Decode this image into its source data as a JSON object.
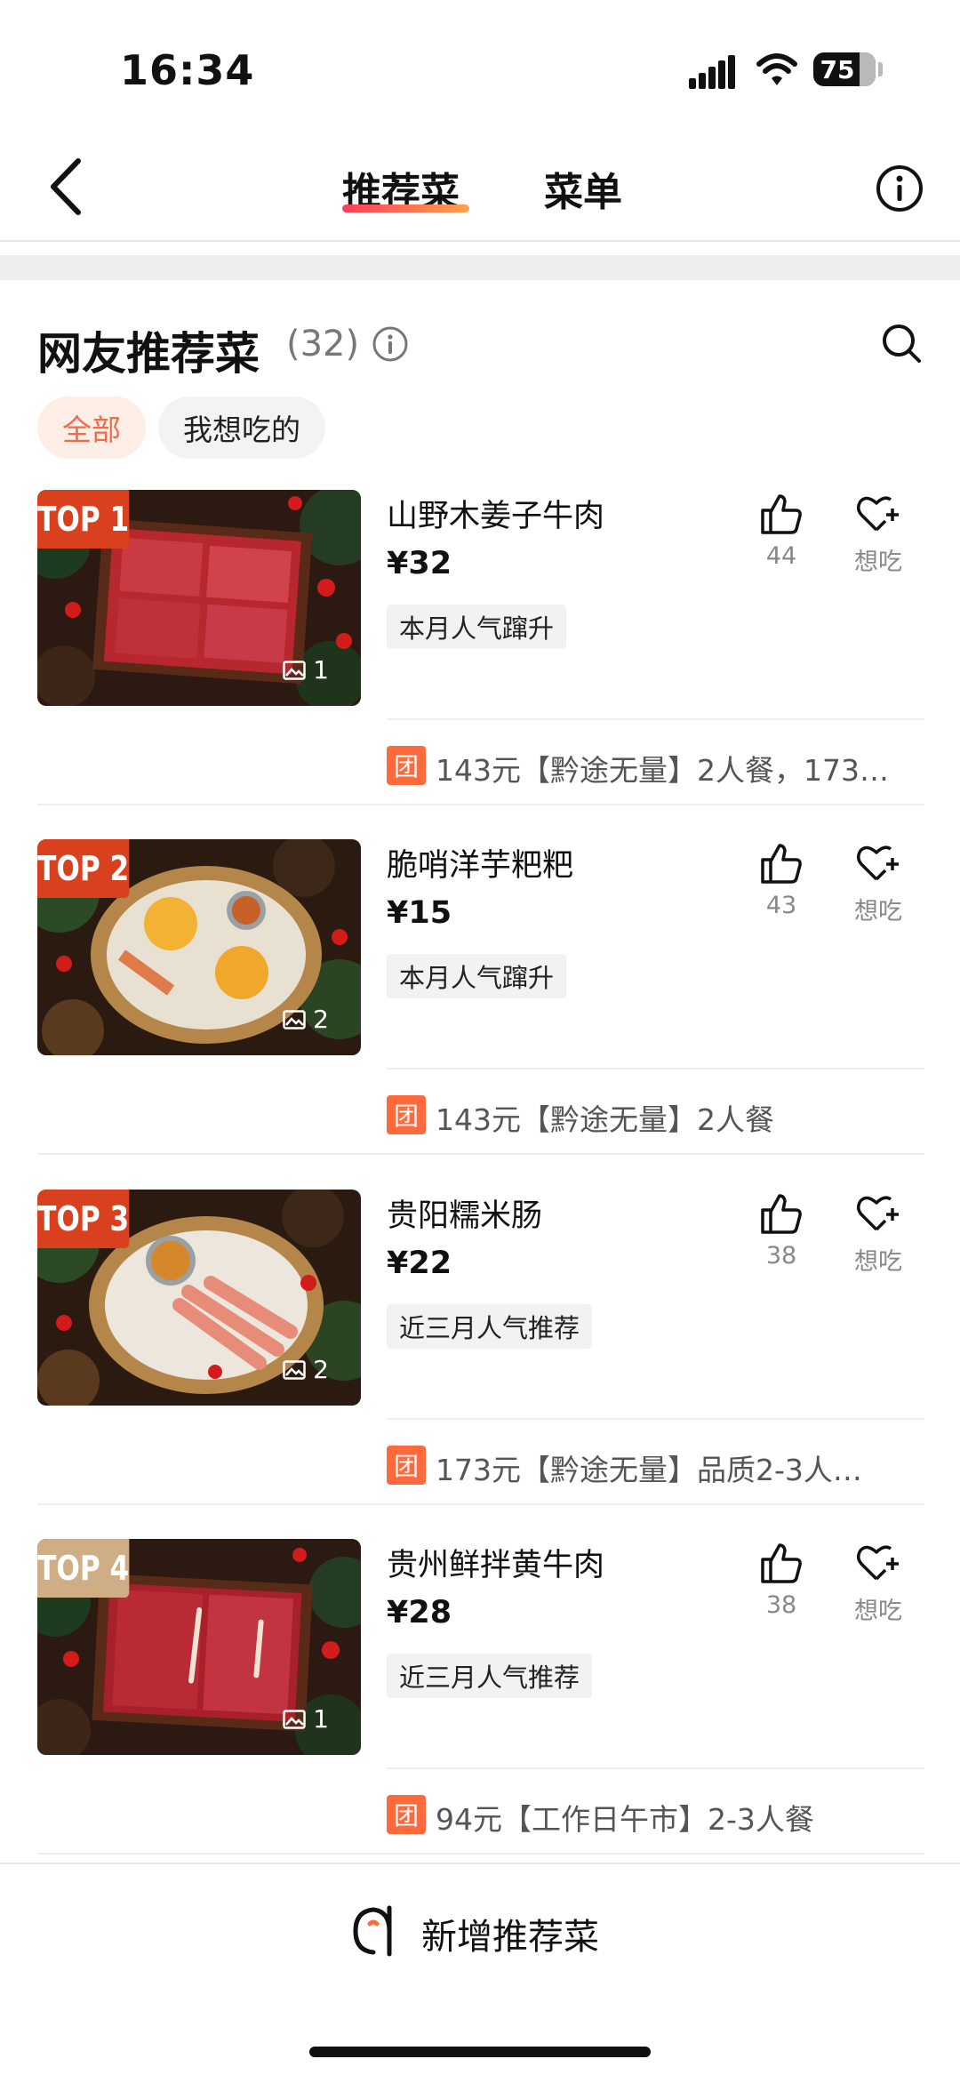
{
  "status_bar": {
    "time": "16:34",
    "battery": "75",
    "battery_level": 0.75
  },
  "nav": {
    "back_icon": "chevron-left-icon",
    "tabs": [
      {
        "label": "推荐菜",
        "active": true
      },
      {
        "label": "菜单",
        "active": false
      }
    ],
    "info_icon": "info-icon"
  },
  "section": {
    "title": "网友推荐菜",
    "count": "(32)",
    "filters": [
      {
        "label": "全部",
        "active": true
      },
      {
        "label": "我想吃的",
        "active": false
      }
    ]
  },
  "colors": {
    "accent": "#f26b46",
    "top_badge": "#d9411e",
    "top_badge_4": "#cfae86",
    "deal_icon": "#ff6a3d"
  },
  "dishes": [
    {
      "rank": "TOP 1",
      "name": "山野木姜子牛肉",
      "price": "¥32",
      "tag": "本月人气蹿升",
      "photos": "1",
      "likes": "44",
      "want_label": "想吃",
      "deal_icon": "团",
      "deal": "143元【黔途无量】2人餐，173…"
    },
    {
      "rank": "TOP 2",
      "name": "脆哨洋芋粑粑",
      "price": "¥15",
      "tag": "本月人气蹿升",
      "photos": "2",
      "likes": "43",
      "want_label": "想吃",
      "deal_icon": "团",
      "deal": "143元【黔途无量】2人餐"
    },
    {
      "rank": "TOP 3",
      "name": "贵阳糯米肠",
      "price": "¥22",
      "tag": "近三月人气推荐",
      "photos": "2",
      "likes": "38",
      "want_label": "想吃",
      "deal_icon": "团",
      "deal": "173元【黔途无量】品质2-3人…"
    },
    {
      "rank": "TOP 4",
      "name": "贵州鲜拌黄牛肉",
      "price": "¥28",
      "tag": "近三月人气推荐",
      "photos": "1",
      "likes": "38",
      "want_label": "想吃",
      "deal_icon": "团",
      "deal": "94元【工作日午市】2-3人餐"
    }
  ],
  "bottom": {
    "add_label": "新增推荐菜",
    "add_icon": "add-dish-icon"
  }
}
